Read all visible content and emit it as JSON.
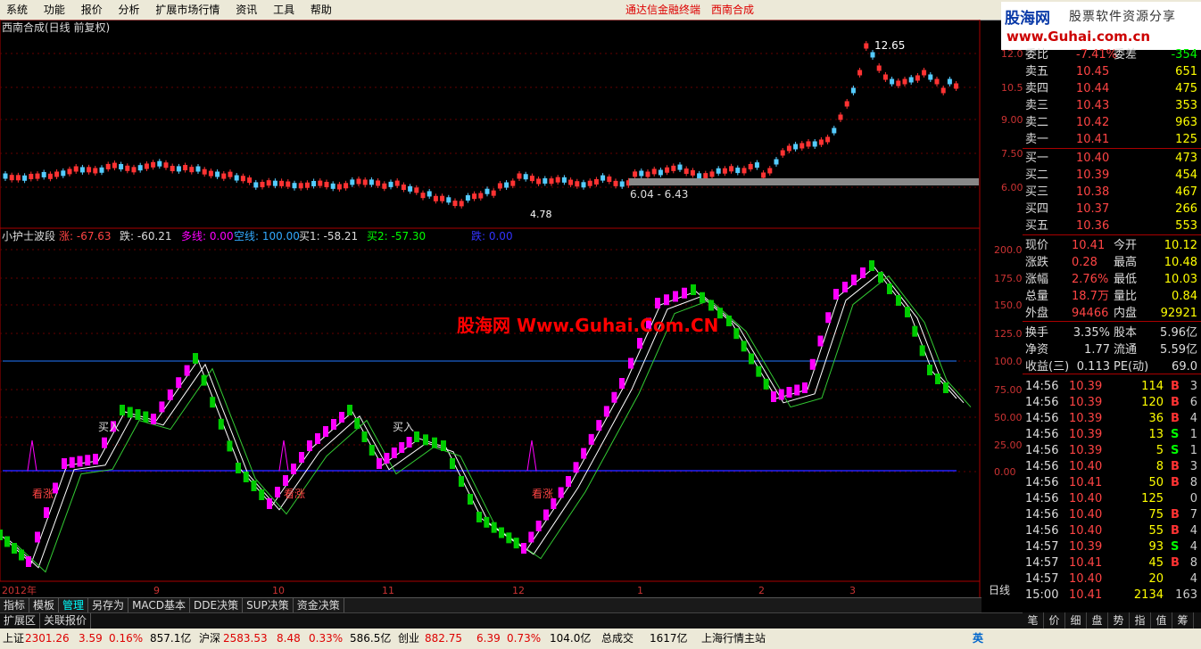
{
  "menu": {
    "items": [
      "系统",
      "功能",
      "报价",
      "分析",
      "扩展市场行情",
      "资讯",
      "工具",
      "帮助"
    ],
    "center1": "通达信金融终端",
    "center2": "西南合成"
  },
  "logo": {
    "name": "股海网",
    "slogan": "股票软件资源分享",
    "url": "www.Guhai.com.cn"
  },
  "chart": {
    "title": "西南合成(日线 前复权)",
    "price_ticks": [
      "12.00",
      "10.50",
      "9.00",
      "7.50",
      "6.00"
    ],
    "high_label": "12.65",
    "low_label": "4.78",
    "range_label": "6.04 - 6.43",
    "indicator": {
      "name": "小护士波段",
      "zhang": "涨: -67.63",
      "die": "跌: -60.21",
      "duoxian": "多线: 0.00",
      "kongxian": "空线: 100.00",
      "mai1": "买1: -58.21",
      "mai2": "买2: -57.30",
      "die2": "跌: 0.00"
    },
    "ind_ticks": [
      "200.0",
      "175.0",
      "150.0",
      "125.0",
      "100.0",
      "75.00",
      "50.00",
      "25.00",
      "0.00"
    ],
    "watermark": "股海网 Www.Guhai.Com.CN",
    "annotations": {
      "buy": "买入",
      "bull": "看涨"
    },
    "date_labels": [
      "2012年",
      "9",
      "10",
      "11",
      "12",
      "1",
      "2",
      "3"
    ],
    "period": "日线"
  },
  "quote": {
    "weibi_label": "委比",
    "weibi": "-7.41%",
    "weicha_label": "委差",
    "weicha": "-354",
    "asks": [
      {
        "label": "卖五",
        "price": "10.45",
        "vol": "651"
      },
      {
        "label": "卖四",
        "price": "10.44",
        "vol": "475"
      },
      {
        "label": "卖三",
        "price": "10.43",
        "vol": "353"
      },
      {
        "label": "卖二",
        "price": "10.42",
        "vol": "963"
      },
      {
        "label": "卖一",
        "price": "10.41",
        "vol": "125"
      }
    ],
    "bids": [
      {
        "label": "买一",
        "price": "10.40",
        "vol": "473"
      },
      {
        "label": "买二",
        "price": "10.39",
        "vol": "454"
      },
      {
        "label": "买三",
        "price": "10.38",
        "vol": "467"
      },
      {
        "label": "买四",
        "price": "10.37",
        "vol": "266"
      },
      {
        "label": "买五",
        "price": "10.36",
        "vol": "553"
      }
    ],
    "stats": [
      {
        "l1": "现价",
        "v1": "10.41",
        "l2": "今开",
        "v2": "10.12"
      },
      {
        "l1": "涨跌",
        "v1": "0.28",
        "l2": "最高",
        "v2": "10.48"
      },
      {
        "l1": "涨幅",
        "v1": "2.76%",
        "l2": "最低",
        "v2": "10.03"
      },
      {
        "l1": "总量",
        "v1": "18.7万",
        "l2": "量比",
        "v2": "0.84"
      },
      {
        "l1": "外盘",
        "v1": "94466",
        "l2": "内盘",
        "v2": "92921"
      }
    ],
    "stats2": [
      {
        "l1": "换手",
        "v1": "3.35%",
        "l2": "股本",
        "v2": "5.96亿"
      },
      {
        "l1": "净资",
        "v1": "1.77",
        "l2": "流通",
        "v2": "5.59亿"
      },
      {
        "l1": "收益(三)",
        "v1": "0.113",
        "l2": "PE(动)",
        "v2": "69.0"
      }
    ],
    "trades": [
      {
        "t": "14:56",
        "p": "10.39",
        "v": "114",
        "bs": "B",
        "n": "3"
      },
      {
        "t": "14:56",
        "p": "10.39",
        "v": "120",
        "bs": "B",
        "n": "6"
      },
      {
        "t": "14:56",
        "p": "10.39",
        "v": "36",
        "bs": "B",
        "n": "4"
      },
      {
        "t": "14:56",
        "p": "10.39",
        "v": "13",
        "bs": "S",
        "n": "1"
      },
      {
        "t": "14:56",
        "p": "10.39",
        "v": "5",
        "bs": "S",
        "n": "1"
      },
      {
        "t": "14:56",
        "p": "10.40",
        "v": "8",
        "bs": "B",
        "n": "3"
      },
      {
        "t": "14:56",
        "p": "10.41",
        "v": "50",
        "bs": "B",
        "n": "8"
      },
      {
        "t": "14:56",
        "p": "10.40",
        "v": "125",
        "bs": "",
        "n": "0"
      },
      {
        "t": "14:56",
        "p": "10.40",
        "v": "75",
        "bs": "B",
        "n": "7"
      },
      {
        "t": "14:56",
        "p": "10.40",
        "v": "55",
        "bs": "B",
        "n": "4"
      },
      {
        "t": "14:57",
        "p": "10.39",
        "v": "93",
        "bs": "S",
        "n": "4"
      },
      {
        "t": "14:57",
        "p": "10.41",
        "v": "45",
        "bs": "B",
        "n": "8"
      },
      {
        "t": "14:57",
        "p": "10.40",
        "v": "20",
        "bs": "",
        "n": "4"
      },
      {
        "t": "15:00",
        "p": "10.41",
        "v": "2134",
        "bs": "",
        "n": "163"
      }
    ]
  },
  "tabs": [
    "指标",
    "模板",
    "管理",
    "另存为",
    "MACD基本",
    "DDE决策",
    "SUP决策",
    "资金决策"
  ],
  "subbar": [
    "扩展区",
    "关联报价"
  ],
  "rtabs": [
    "笔",
    "价",
    "细",
    "盘",
    "势",
    "指",
    "值",
    "筹"
  ],
  "status": {
    "sh_label": "上证",
    "sh": "2301.26",
    "sh_chg": "3.59",
    "sh_pct": "0.16%",
    "sh_amt": "857.1亿",
    "sz_label": "沪深",
    "sz": "2583.53",
    "sz_chg": "8.48",
    "sz_pct": "0.33%",
    "sz_amt": "586.5亿",
    "cy_label": "创业",
    "cy": "882.75",
    "cy_chg": "6.39",
    "cy_pct": "0.73%",
    "cy_amt": "104.0亿",
    "total_label": "总成交",
    "total": "1617亿",
    "station": "上海行情主站",
    "ime": "英"
  }
}
